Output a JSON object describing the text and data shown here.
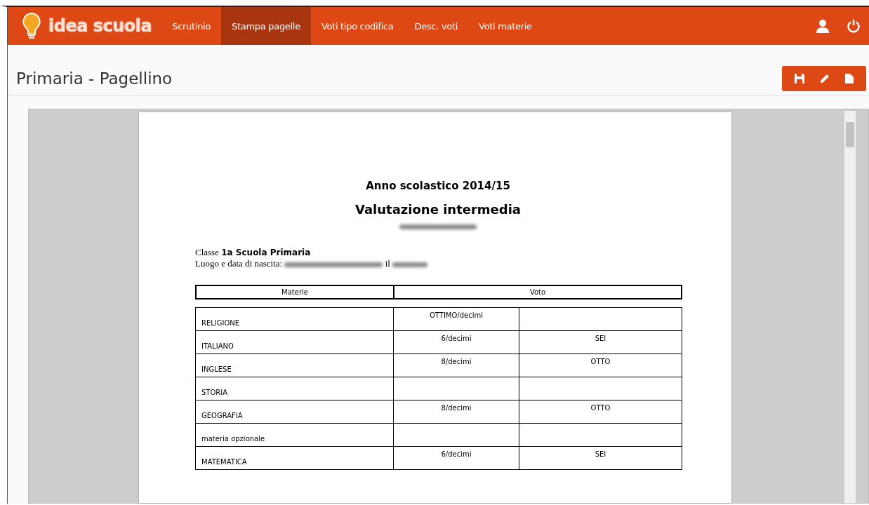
{
  "brand": "idea scuola",
  "nav": [
    {
      "label": "Scrutinio",
      "selected": false
    },
    {
      "label": "Stampa pagelle",
      "selected": true
    },
    {
      "label": "Voti tipo codifica",
      "selected": false
    },
    {
      "label": "Desc. voti",
      "selected": false
    },
    {
      "label": "Voti materie",
      "selected": false
    }
  ],
  "page_title": "Primaria - Pagellino",
  "document": {
    "year": "Anno scolastico 2014/15",
    "heading": "Valutazione intermedia",
    "class_label": "Classe",
    "class_value": "1a Scuola Primaria",
    "birth_label": "Luogo e data di nascita:",
    "birth_joiner": "il",
    "columns": [
      "Materie",
      "Voto"
    ],
    "rows": [
      {
        "subject": "RELIGIONE",
        "grade": "OTTIMO/decimi"
      },
      {
        "subject": "ITALIANO",
        "grade": "6/decimi",
        "words": "SEI"
      },
      {
        "subject": "INGLESE",
        "grade": "8/decimi",
        "words": "OTTO"
      },
      {
        "subject": "STORIA"
      },
      {
        "subject": "GEOGRAFIA",
        "grade": "8/decimi",
        "words": "OTTO"
      },
      {
        "subject": "materia opzionale"
      },
      {
        "subject": "MATEMATICA",
        "grade": "6/decimi",
        "words": "SEI"
      }
    ]
  }
}
